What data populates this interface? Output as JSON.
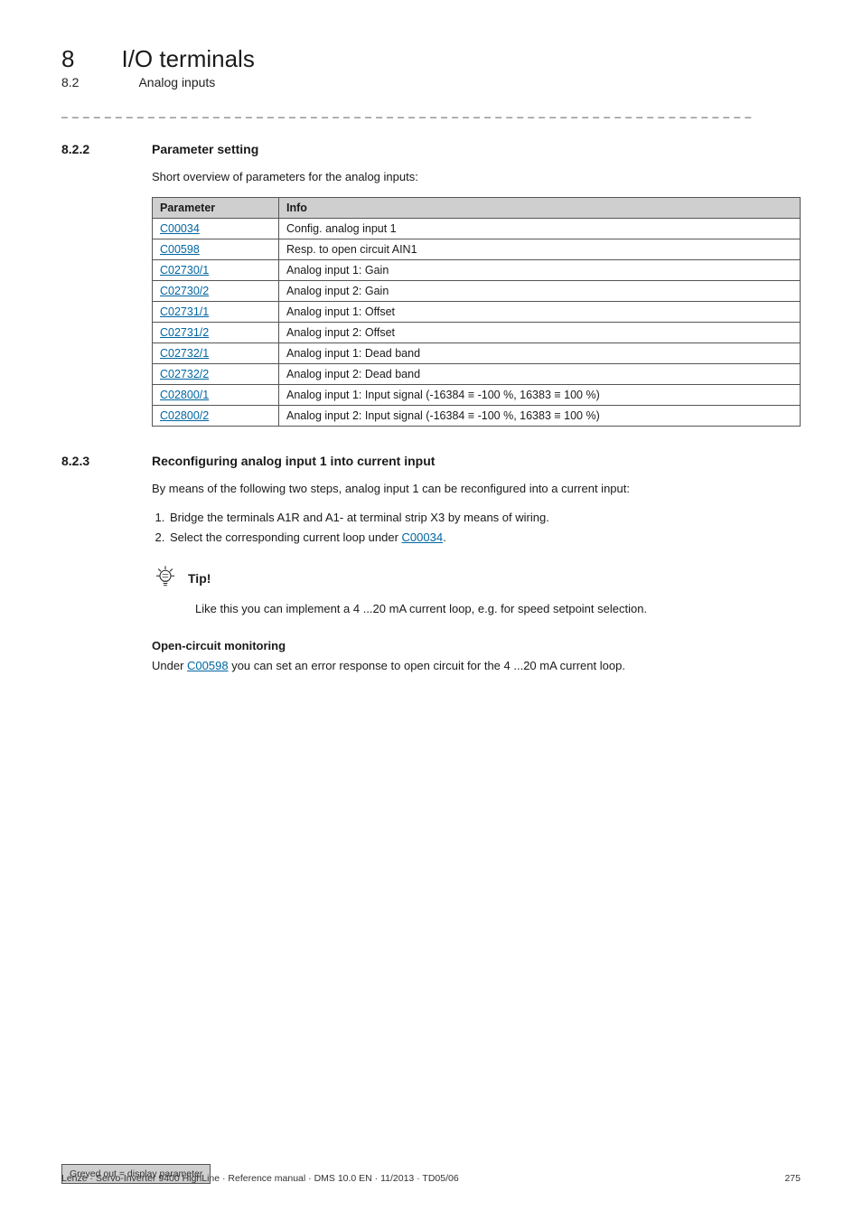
{
  "chapter": {
    "num": "8",
    "title": "I/O terminals"
  },
  "breadcrumb": {
    "num": "8.2",
    "title": "Analog inputs"
  },
  "dash_rule": "_ _ _ _ _ _ _ _ _ _ _ _ _ _ _ _ _ _ _ _ _ _ _ _ _ _ _ _ _ _ _ _ _ _ _ _ _ _ _ _ _ _ _ _ _ _ _ _ _ _ _ _ _ _ _ _ _ _ _ _ _ _ _ _",
  "section_822": {
    "num": "8.2.2",
    "title": "Parameter setting",
    "intro": "Short overview of parameters for the analog inputs:",
    "table": {
      "headers": [
        "Parameter",
        "Info"
      ],
      "rows": [
        {
          "param": "C00034",
          "info": "Config. analog input 1"
        },
        {
          "param": "C00598",
          "info": "Resp. to open circuit AIN1"
        },
        {
          "param": "C02730/1",
          "info": "Analog input 1: Gain"
        },
        {
          "param": "C02730/2",
          "info": "Analog input 2: Gain"
        },
        {
          "param": "C02731/1",
          "info": "Analog input 1: Offset"
        },
        {
          "param": "C02731/2",
          "info": "Analog input 2: Offset"
        },
        {
          "param": "C02732/1",
          "info": "Analog input 1: Dead band"
        },
        {
          "param": "C02732/2",
          "info": "Analog input 2: Dead band"
        },
        {
          "param": "C02800/1",
          "info": "Analog input 1: Input signal (-16384 ≡ -100 %, 16383 ≡ 100 %)"
        },
        {
          "param": "C02800/2",
          "info": "Analog input 2: Input signal (-16384 ≡ -100 %, 16383 ≡ 100 %)"
        }
      ],
      "footer_note": "Greyed out = display parameter"
    }
  },
  "section_823": {
    "num": "8.2.3",
    "title": "Reconfiguring analog input 1 into current input",
    "intro": "By means of the following two steps, analog input 1 can be reconfigured into a current input:",
    "steps": [
      "Bridge the terminals A1R and A1- at terminal strip X3 by means of wiring.",
      "Select the corresponding current loop under "
    ],
    "step2_link": "C00034",
    "step2_suffix": ".",
    "tip_label": "Tip!",
    "tip_text": "Like this you can implement a 4 ...20 mA current loop, e.g. for speed setpoint selection.",
    "open_circuit": {
      "heading": "Open-circuit monitoring",
      "prefix": "Under ",
      "link": "C00598",
      "suffix": " you can set an error response to open circuit for the 4 ...20 mA current loop."
    }
  },
  "footer": {
    "left": "Lenze · Servo-Inverter 9400 HighLine · Reference manual · DMS 10.0 EN · 11/2013 · TD05/06",
    "right": "275"
  }
}
